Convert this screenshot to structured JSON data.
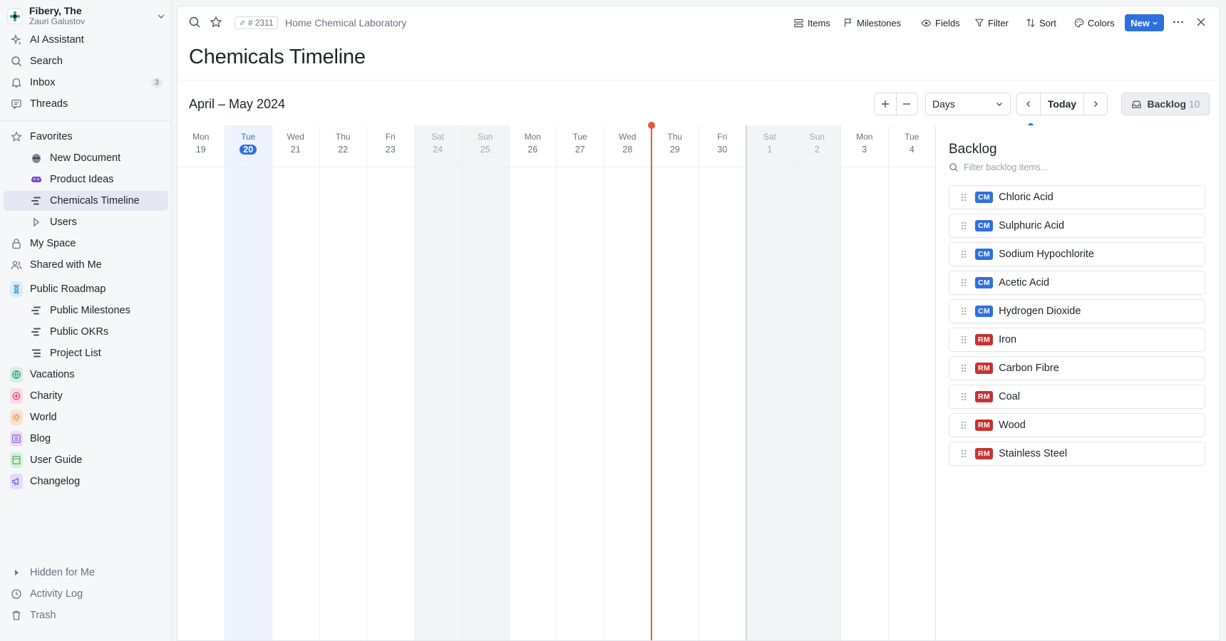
{
  "workspace": {
    "name": "Fibery, The",
    "user": "Zauri Galustov"
  },
  "sidebar": {
    "top": [
      {
        "label": "AI Assistant",
        "icon": "sparkle-icon"
      },
      {
        "label": "Search",
        "icon": "search-icon"
      },
      {
        "label": "Inbox",
        "icon": "bell-icon",
        "count": "3"
      },
      {
        "label": "Threads",
        "icon": "threads-icon"
      }
    ],
    "favorites_label": "Favorites",
    "favorites": [
      {
        "label": "New Document",
        "icon": "alien-icon"
      },
      {
        "label": "Product Ideas",
        "icon": "space-invader-icon"
      },
      {
        "label": "Chemicals Timeline",
        "icon": "timeline-icon"
      },
      {
        "label": "Users",
        "icon": "play-outline-icon"
      }
    ],
    "my_space": "My Space",
    "shared": "Shared with Me",
    "public_roadmap": "Public Roadmap",
    "roadmap_children": [
      {
        "label": "Public Milestones"
      },
      {
        "label": "Public OKRs"
      },
      {
        "label": "Project List"
      }
    ],
    "apps": [
      {
        "label": "Vacations",
        "color": "#3aa07a"
      },
      {
        "label": "Charity",
        "color": "#e0527a"
      },
      {
        "label": "World",
        "color": "#e07a3a"
      },
      {
        "label": "Blog",
        "color": "#8a5ad6"
      },
      {
        "label": "User Guide",
        "color": "#3fae5a"
      },
      {
        "label": "Changelog",
        "color": "#6a5ae0"
      }
    ],
    "bottom": [
      {
        "label": "Hidden for Me"
      },
      {
        "label": "Activity Log"
      },
      {
        "label": "Trash"
      }
    ]
  },
  "topbar": {
    "entity_id": "2311",
    "breadcrumb": "Home Chemical Laboratory",
    "items": "Items",
    "milestones": "Milestones",
    "fields": "Fields",
    "filter": "Filter",
    "sort": "Sort",
    "colors": "Colors",
    "new": "New"
  },
  "page": {
    "title": "Chemicals Timeline"
  },
  "timeline": {
    "range": "April – May 2024",
    "scale": "Days",
    "today_label": "Today",
    "backlog_label": "Backlog",
    "backlog_count": "10",
    "days": [
      {
        "name": "Mon",
        "date": "19"
      },
      {
        "name": "Tue",
        "date": "20",
        "today": true
      },
      {
        "name": "Wed",
        "date": "21"
      },
      {
        "name": "Thu",
        "date": "22"
      },
      {
        "name": "Fri",
        "date": "23"
      },
      {
        "name": "Sat",
        "date": "24",
        "weekend": true
      },
      {
        "name": "Sun",
        "date": "25",
        "weekend": true
      },
      {
        "name": "Mon",
        "date": "26"
      },
      {
        "name": "Tue",
        "date": "27"
      },
      {
        "name": "Wed",
        "date": "28"
      },
      {
        "name": "Thu",
        "date": "29"
      },
      {
        "name": "Fri",
        "date": "30"
      },
      {
        "name": "Sat",
        "date": "1",
        "weekend": true
      },
      {
        "name": "Sun",
        "date": "2",
        "weekend": true
      },
      {
        "name": "Mon",
        "date": "3"
      },
      {
        "name": "Tue",
        "date": "4"
      }
    ]
  },
  "backlog": {
    "title": "Backlog",
    "filter_placeholder": "Filter backlog items...",
    "items": [
      {
        "badge": "CM",
        "name": "Chloric Acid"
      },
      {
        "badge": "CM",
        "name": "Sulphuric Acid"
      },
      {
        "badge": "CM",
        "name": "Sodium Hypochlorite"
      },
      {
        "badge": "CM",
        "name": "Acetic Acid"
      },
      {
        "badge": "CM",
        "name": "Hydrogen Dioxide"
      },
      {
        "badge": "RM",
        "name": "Iron"
      },
      {
        "badge": "RM",
        "name": "Carbon Fibre"
      },
      {
        "badge": "RM",
        "name": "Coal"
      },
      {
        "badge": "RM",
        "name": "Wood"
      },
      {
        "badge": "RM",
        "name": "Stainless Steel"
      }
    ],
    "badge_colors": {
      "CM": "#2f6fe0",
      "RM": "#c83232"
    }
  },
  "colors": {
    "accent": "#2f6fe0",
    "now_line": "#ea5a3a"
  }
}
